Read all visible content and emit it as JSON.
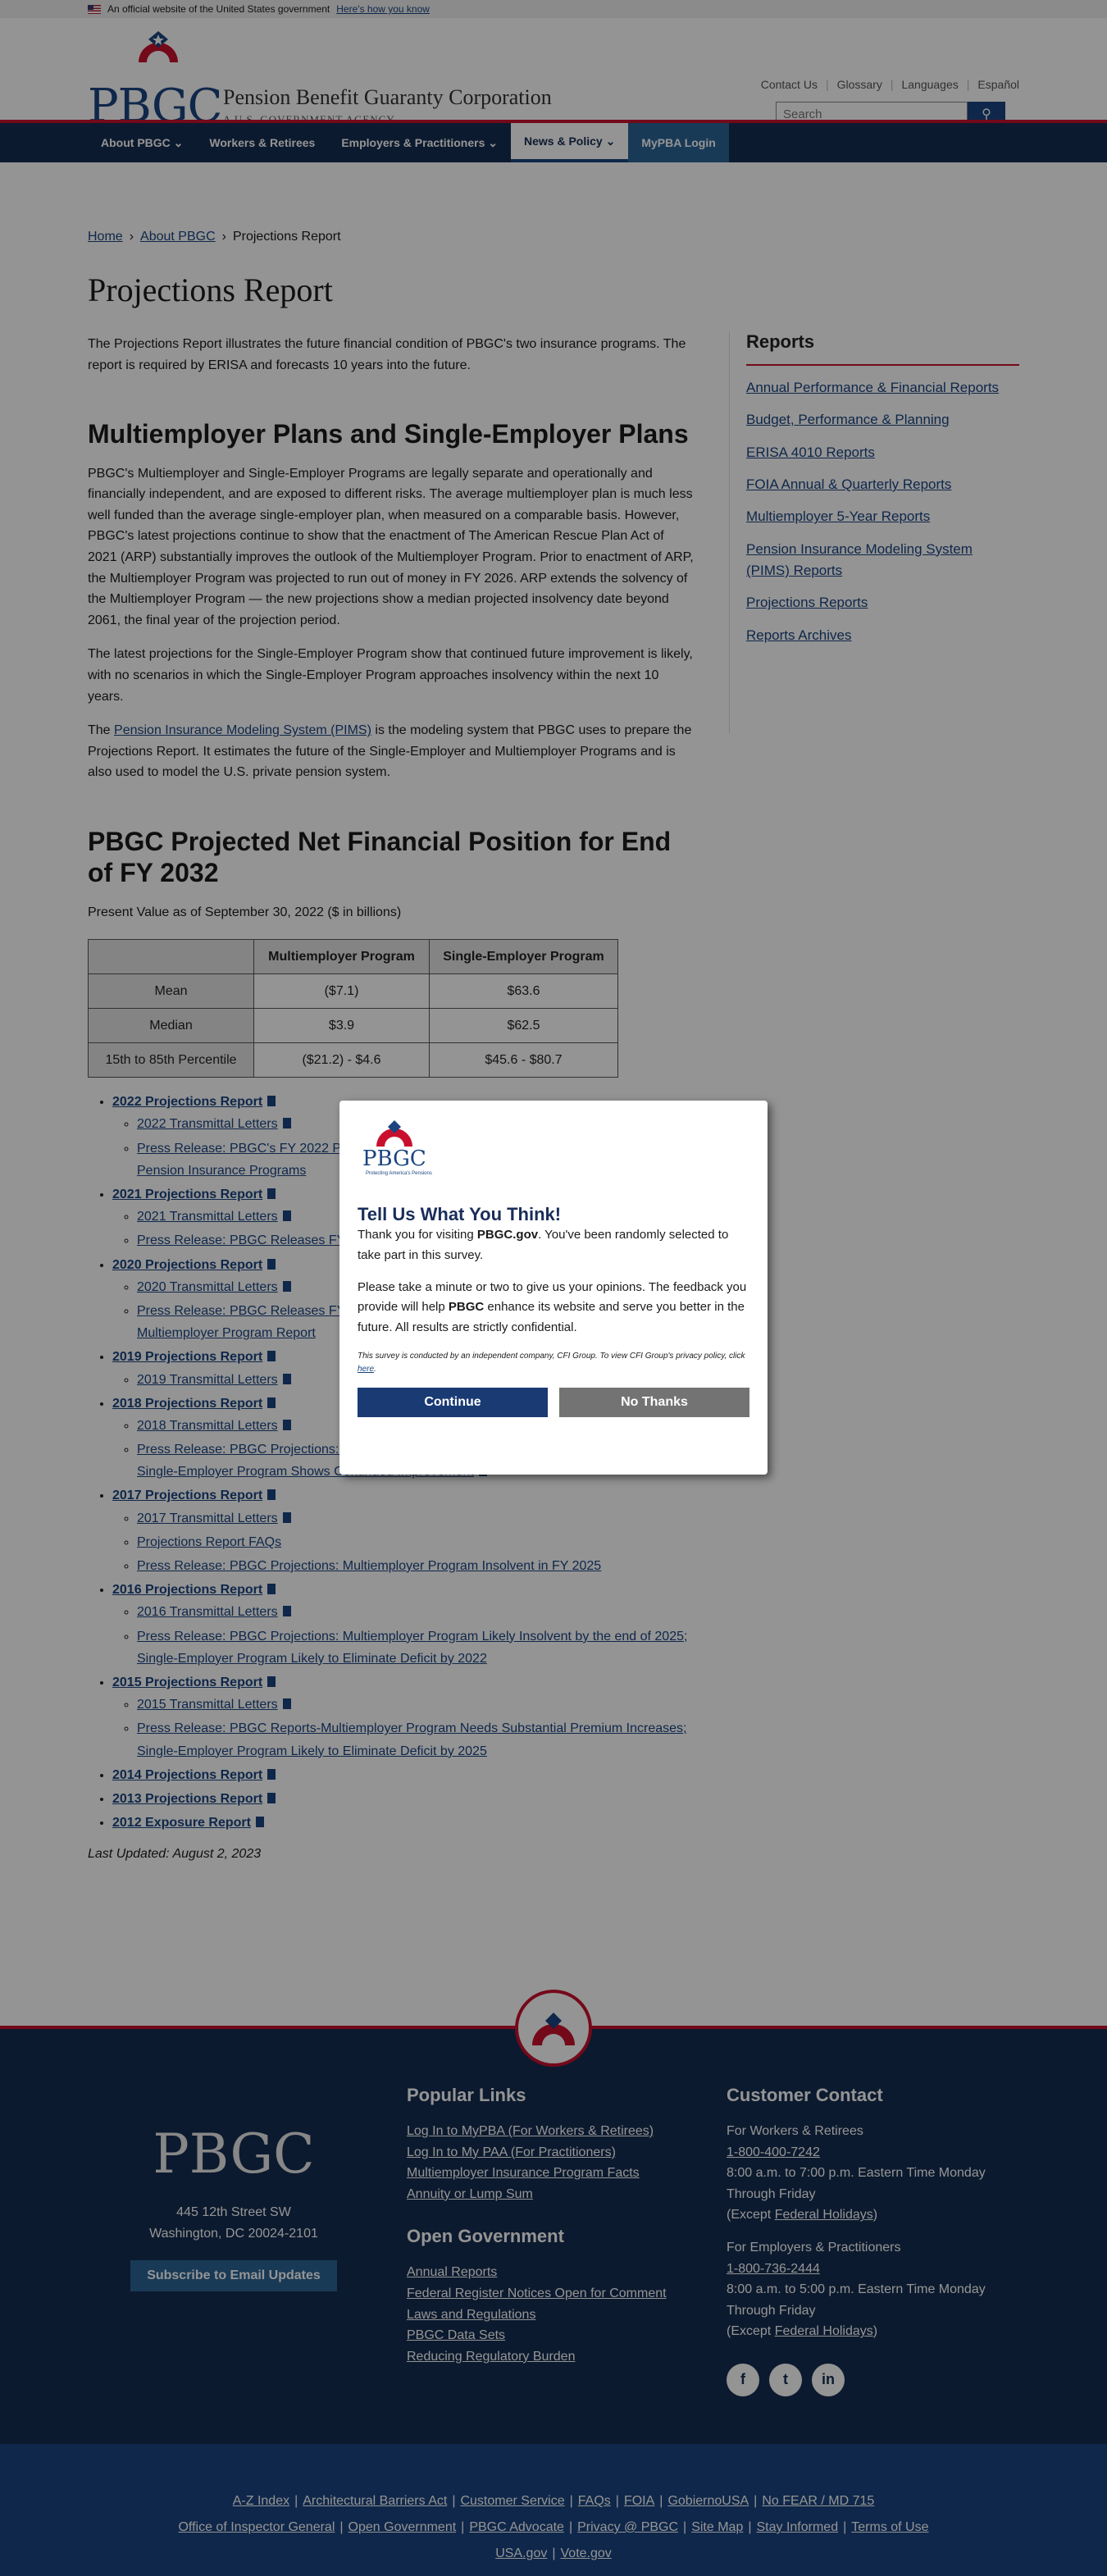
{
  "gov_banner": {
    "text": "An official website of the United States government",
    "link": "Here's how you know"
  },
  "header": {
    "logo": "PBGC",
    "agency_name": "Pension Benefit Guaranty Corporation",
    "agency_sub": "A U.S. GOVERNMENT AGENCY",
    "util_links": [
      "Contact Us",
      "Glossary",
      "Languages",
      "Español"
    ],
    "search_placeholder": "Search"
  },
  "nav": {
    "items": [
      "About PBGC",
      "Workers & Retirees",
      "Employers & Practitioners",
      "News & Policy",
      "MyPBA Login"
    ]
  },
  "breadcrumb": [
    "Home",
    "About PBGC",
    "Projections Report"
  ],
  "page_title": "Projections Report",
  "intro": "The Projections Report illustrates the future financial condition of PBGC's two insurance programs. The report is required by ERISA and forecasts 10 years into the future.",
  "section1": {
    "heading": "Multiemployer Plans and Single-Employer Plans",
    "p1": "PBGC's Multiemployer and Single-Employer Programs are legally separate and operationally and financially independent, and are exposed to different risks. The average multiemployer plan is much less well funded than the average single-employer plan, when measured on a comparable basis. However, PBGC's latest projections continue to show that the enactment of The American Rescue Plan Act of 2021 (ARP) substantially improves the outlook of the Multiemployer Program. Prior to enactment of ARP, the Multiemployer Program was projected to run out of money in FY 2026. ARP extends the solvency of the Multiemployer Program — the new projections show a median projected insolvency date beyond 2061, the final year of the projection period.",
    "p2": "The latest projections for the Single-Employer Program show that continued future improvement is likely, with no scenarios in which the Single-Employer Program approaches insolvency within the next 10 years.",
    "p3_pre": "The ",
    "p3_link": "Pension Insurance Modeling System (PIMS)",
    "p3_post": " is the modeling system that PBGC uses to prepare the Projections Report. It estimates the future of the Single-Employer and Multiemployer Programs and is also used to model the U.S. private pension system."
  },
  "section2": {
    "heading": "PBGC Projected Net Financial Position for End of FY 2032",
    "subtitle": "Present Value as of September 30, 2022 ($ in billions)",
    "table": {
      "headers": [
        "",
        "Multiemployer Program",
        "Single-Employer Program"
      ],
      "rows": [
        [
          "Mean",
          "($7.1)",
          "$63.6"
        ],
        [
          "Median",
          "$3.9",
          "$62.5"
        ],
        [
          "15th to 85th Percentile",
          "($21.2) - $4.6",
          "$45.6 - $80.7"
        ]
      ]
    }
  },
  "reports": [
    {
      "label": "2022 Projections Report",
      "pdf": true,
      "children": [
        {
          "label": "2022 Transmittal Letters",
          "pdf": true
        },
        {
          "label": "Press Release: PBGC's FY 2022 Projections Report Shows Continued Financial Strength in its Pension Insurance Programs",
          "pdf": false
        }
      ]
    },
    {
      "label": "2021 Projections Report",
      "pdf": true,
      "children": [
        {
          "label": "2021 Transmittal Letters",
          "pdf": true
        },
        {
          "label": "Press Release: PBGC Releases FY 2021 Projections Report",
          "pdf": false
        }
      ]
    },
    {
      "label": "2020 Projections Report",
      "pdf": true,
      "children": [
        {
          "label": "2020 Transmittal Letters",
          "pdf": true
        },
        {
          "label": "Press Release: PBGC Releases FY 2020 Projections Report: Continued Outlook for Multiemployer Program Report",
          "pdf": false
        }
      ]
    },
    {
      "label": "2019 Projections Report",
      "pdf": true,
      "children": [
        {
          "label": "2019 Transmittal Letters",
          "pdf": true
        }
      ]
    },
    {
      "label": "2018 Projections Report",
      "pdf": true,
      "children": [
        {
          "label": "2018 Transmittal Letters",
          "pdf": true
        },
        {
          "label": "Press Release: PBGC Projections: Multiemployer Program Remains in Dire Financial Condition; Single-Employer Program Shows Continued Improvement",
          "pdf": true
        }
      ]
    },
    {
      "label": "2017 Projections Report",
      "pdf": true,
      "children": [
        {
          "label": "2017 Transmittal Letters",
          "pdf": true
        },
        {
          "label": "Projections Report FAQs",
          "pdf": false
        },
        {
          "label": "Press Release: PBGC Projections: Multiemployer Program Insolvent in FY 2025",
          "pdf": false
        }
      ]
    },
    {
      "label": "2016 Projections Report",
      "pdf": true,
      "children": [
        {
          "label": "2016 Transmittal Letters",
          "pdf": true
        },
        {
          "label": "Press Release: PBGC Projections: Multiemployer Program Likely Insolvent by the end of 2025; Single-Employer Program Likely to Eliminate Deficit by 2022",
          "pdf": false
        }
      ]
    },
    {
      "label": "2015 Projections Report",
      "pdf": true,
      "children": [
        {
          "label": "2015 Transmittal Letters",
          "pdf": true
        },
        {
          "label": "Press Release: PBGC Reports-Multiemployer Program Needs Substantial Premium Increases; Single-Employer Program Likely to Eliminate Deficit by 2025",
          "pdf": false
        }
      ]
    },
    {
      "label": "2014 Projections Report",
      "pdf": true,
      "children": []
    },
    {
      "label": "2013 Projections Report",
      "pdf": true,
      "children": []
    },
    {
      "label": "2012 Exposure Report",
      "pdf": true,
      "children": []
    }
  ],
  "last_updated": "Last Updated: August 2, 2023",
  "sidebar": {
    "title": "Reports",
    "links": [
      "Annual Performance & Financial Reports",
      "Budget, Performance & Planning",
      "ERISA 4010 Reports",
      "FOIA Annual & Quarterly Reports",
      "Multiemployer 5-Year Reports",
      "Pension Insurance Modeling System (PIMS) Reports",
      "Projections Reports",
      "Reports Archives"
    ]
  },
  "modal": {
    "logo": "PBGC",
    "logo_tag": "Protecting America's Pensions",
    "title": "Tell Us What You Think!",
    "p1_pre": "Thank you for visiting ",
    "p1_bold": "PBGC.gov",
    "p1_post": ". You've been randomly selected to take part in this survey.",
    "p2_pre": "Please take a minute or two to give us your opinions. The feedback you provide will help ",
    "p2_bold": "PBGC",
    "p2_post": " enhance its website and serve you better in the future. All results are strictly confidential.",
    "small_pre": "This survey is conducted by an independent company, CFI Group. To view CFI Group's privacy policy, click ",
    "small_link": "here",
    "small_post": ".",
    "continue": "Continue",
    "no_thanks": "No Thanks"
  },
  "footer": {
    "logo": "PBGC",
    "address1": "445 12th Street SW",
    "address2": "Washington, DC 20024-2101",
    "subscribe": "Subscribe to Email Updates",
    "popular_title": "Popular Links",
    "popular": [
      "Log In to MyPBA (For Workers & Retirees)",
      "Log In to My PAA (For Practitioners)",
      "Multiemployer Insurance Program Facts",
      "Annuity or Lump Sum"
    ],
    "open_title": "Open Government",
    "open": [
      "Annual Reports",
      "Federal Register Notices Open for Comment",
      "Laws and Regulations",
      "PBGC Data Sets",
      "Reducing Regulatory Burden"
    ],
    "contact_title": "Customer Contact",
    "workers_label": "For Workers & Retirees",
    "workers_phone": "1-800-400-7242",
    "workers_hours": "8:00 a.m. to 7:00 p.m. Eastern Time Monday Through Friday",
    "except_pre": "(Except ",
    "except_link": "Federal Holidays",
    "except_post": ")",
    "employers_label": "For Employers & Practitioners",
    "employers_phone": "1-800-736-2444",
    "employers_hours": "8:00 a.m. to 5:00 p.m. Eastern Time Monday Through Friday",
    "social": [
      "f",
      "t",
      "in"
    ]
  },
  "bottom_links": [
    [
      "A-Z Index",
      "Architectural Barriers Act",
      "Customer Service",
      "FAQs",
      "FOIA",
      "GobiernoUSA",
      "No FEAR / MD 715"
    ],
    [
      "Office of Inspector General",
      "Open Government",
      "PBGC Advocate",
      "Privacy @ PBGC",
      "Site Map",
      "Stay Informed",
      "Terms of Use"
    ],
    [
      "USA.gov",
      "Vote.gov"
    ]
  ]
}
